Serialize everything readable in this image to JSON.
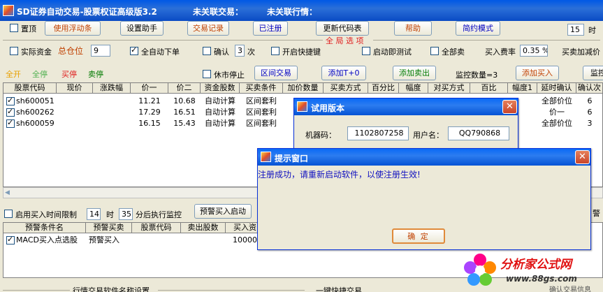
{
  "window": {
    "title": "SD证券自动交易-股票权证高级版3.2",
    "trade_status": "未关联交易：",
    "quote_status": "未关联行情："
  },
  "toolbar": {
    "pin_label": "置顶",
    "move_bar": "使用浮动条",
    "setup_helper": "设置助手",
    "trade_log": "交易记录",
    "registered": "已注册",
    "update_codes": "更新代码表",
    "help": "帮助",
    "simple_mode": "简约模式",
    "hour_value": "15",
    "hour_unit": "时"
  },
  "options": {
    "group_title": "全 局 选 项",
    "real_funds": "实际资金",
    "total_position": "总仓位",
    "position_value": "9",
    "auto_order": "全自动下单",
    "confirm": "确认",
    "confirm_times": "3",
    "times_unit": "次",
    "hotkey": "开启快捷键",
    "startup_test": "启动即测试",
    "sell_all": "全部卖",
    "buy_fee": "买入费率",
    "buy_fee_value": "0.35 %",
    "sell_add_price": "买卖加减价"
  },
  "monitor_bar": {
    "all_start": "全开",
    "all_stop": "全停",
    "buy_stop": "买停",
    "sell_stop": "卖停",
    "market_halt": "休市停止",
    "range_trade": "区间交易",
    "add_t0": "添加T+0",
    "add_sell": "添加卖出",
    "monitor_count": "监控数量=3",
    "add_buy": "添加买入",
    "monitor_short": "监控"
  },
  "main_table": {
    "headers": [
      "股票代码",
      "现价",
      "涨跌幅",
      "价一",
      "价二",
      "资金股数",
      "买卖条件",
      "加价数量",
      "买卖方式",
      "百分比",
      "幅度",
      "对买方式",
      "百比",
      "幅度1",
      "延时确认",
      "确认次"
    ],
    "rows": [
      {
        "code": "sh600051",
        "p1": "11.21",
        "p2": "10.68",
        "funds": "自动计算",
        "cond": "区间套利",
        "delay": "全部价位",
        "confirm": "6"
      },
      {
        "code": "sh600262",
        "p1": "17.29",
        "p2": "16.51",
        "funds": "自动计算",
        "cond": "区间套利",
        "delay": "价一",
        "confirm": "6"
      },
      {
        "code": "sh600059",
        "p1": "16.15",
        "p2": "15.43",
        "funds": "自动计算",
        "cond": "区间套利",
        "delay": "全部价位",
        "confirm": "3"
      }
    ]
  },
  "time_limit": {
    "label": "启用买入时间限制",
    "hour": "14",
    "hour_unit": "时",
    "minute": "35",
    "minute_text": "分后执行监控",
    "alert_start": "预警买入启动",
    "right_cut": "警"
  },
  "alert_table": {
    "headers": [
      "预警条件名",
      "预警买卖",
      "股票代码",
      "卖出股数",
      "买入资"
    ],
    "rows": [
      {
        "name": "MACD买入点选股",
        "type": "预警买入",
        "amount": "100000"
      }
    ]
  },
  "bottom": {
    "software_setting": "行情交易软件名称设置",
    "one_key": "一键快捷交易",
    "right_cut": "确认交易信息"
  },
  "trial_dialog": {
    "title": "试用版本",
    "machine_label": "机器码：",
    "machine_value": "1102807258",
    "user_label": "用户名：",
    "user_value": "QQ790868"
  },
  "prompt_dialog": {
    "title": "提示窗口",
    "message": "注册成功，请重新启动软件，以使注册生效!",
    "ok": "确  定"
  },
  "watermark": {
    "brand": "分析家公式网",
    "url": "www.88gs.com"
  },
  "colors": {
    "title_blue": "#0A4BC4",
    "orange_text": "#C04000",
    "green_text": "#007A00",
    "blue_text": "#0000C0",
    "red_text": "#E02020"
  }
}
